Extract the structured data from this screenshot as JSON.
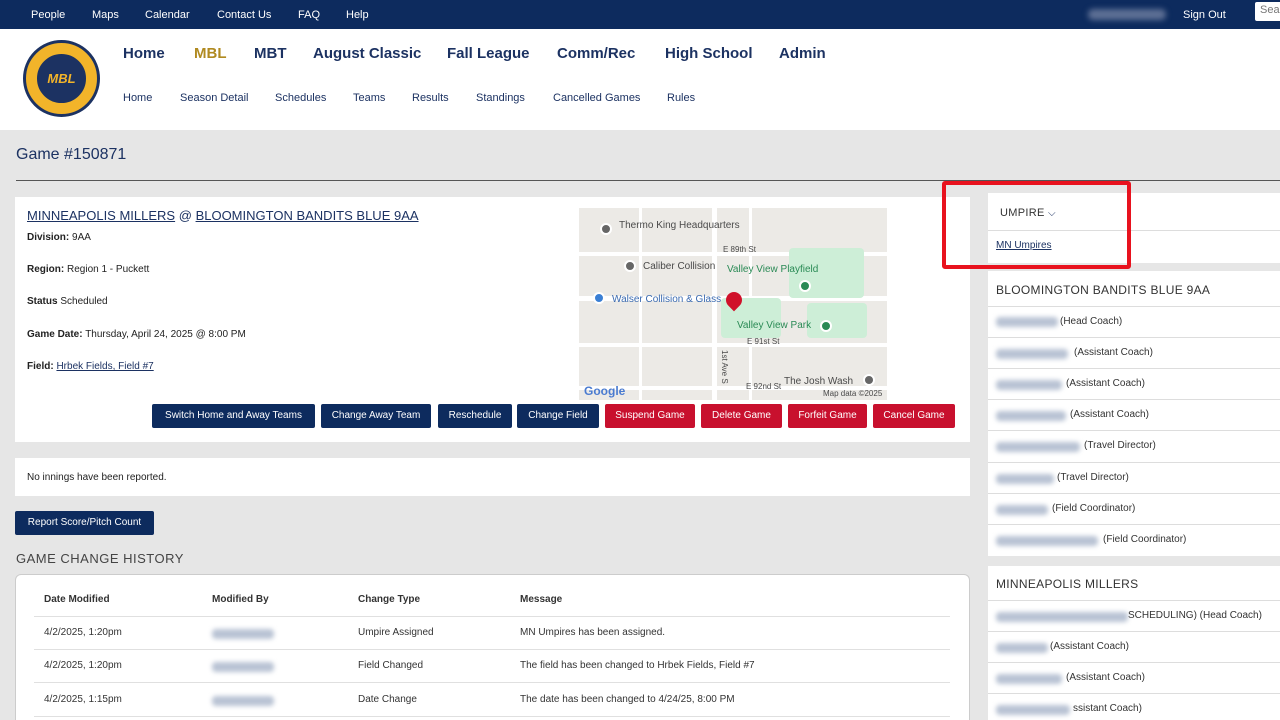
{
  "topnav": {
    "people": "People",
    "maps": "Maps",
    "calendar": "Calendar",
    "contact": "Contact Us",
    "faq": "FAQ",
    "help": "Help",
    "signout": "Sign Out",
    "search_placeholder": "Sea"
  },
  "logo": {
    "text": "MBL"
  },
  "mainnav": [
    "Home",
    "MBL",
    "MBT",
    "August Classic",
    "Fall League",
    "Comm/Rec",
    "High School",
    "Admin"
  ],
  "subnav": [
    "Home",
    "Season Detail",
    "Schedules",
    "Teams",
    "Results",
    "Standings",
    "Cancelled Games",
    "Rules"
  ],
  "page_title": "Game #150871",
  "game": {
    "away_team": "MINNEAPOLIS MILLERS",
    "at": "@",
    "home_team": "BLOOMINGTON BANDITS BLUE 9AA",
    "division_label": "Division:",
    "division": "9AA",
    "region_label": "Region:",
    "region": "Region 1 - Puckett",
    "status_label": "Status",
    "status": "Scheduled",
    "date_label": "Game Date:",
    "date": "Thursday, April 24, 2025 @ 8:00 PM",
    "field_label": "Field:",
    "field": "Hrbek Fields, Field #7"
  },
  "map": {
    "labels": [
      "Thermo King Headquarters",
      "E 89th St",
      "Caliber Collision",
      "Valley View Playfield",
      "Walser Collision & Glass",
      "Valley View Park",
      "E 91st St",
      "1st Ave S",
      "E 92nd St",
      "The Josh Wash",
      "Google",
      "Map data ©2025"
    ]
  },
  "buttons": {
    "switch": "Switch Home and Away Teams",
    "change_away": "Change Away Team",
    "reschedule": "Reschedule",
    "change_field": "Change Field",
    "suspend": "Suspend Game",
    "delete": "Delete Game",
    "forfeit": "Forfeit Game",
    "cancel": "Cancel Game"
  },
  "innings_msg": "No innings have been reported.",
  "report_btn": "Report Score/Pitch Count",
  "history": {
    "title": "GAME CHANGE HISTORY",
    "headers": [
      "Date Modified",
      "Modified By",
      "Change Type",
      "Message"
    ],
    "rows": [
      {
        "date": "4/2/2025, 1:20pm",
        "type": "Umpire Assigned",
        "msg": "MN Umpires has been assigned."
      },
      {
        "date": "4/2/2025, 1:20pm",
        "type": "Field Changed",
        "msg": "The field has been changed to Hrbek Fields, Field #7"
      },
      {
        "date": "4/2/2025, 1:15pm",
        "type": "Date Change",
        "msg": "The date has been changed to 4/24/25, 8:00 PM"
      }
    ]
  },
  "umpire": {
    "title": "UMPIRE",
    "name": "MN Umpires"
  },
  "home_staff": {
    "title": "BLOOMINGTON BANDITS BLUE 9AA",
    "roles": [
      "(Head Coach)",
      "(Assistant Coach)",
      "(Assistant Coach)",
      "(Assistant Coach)",
      "(Travel Director)",
      "(Travel Director)",
      "(Field Coordinator)",
      "(Field Coordinator)"
    ]
  },
  "away_staff": {
    "title": "MINNEAPOLIS MILLERS",
    "roles": [
      "SCHEDULING) (Head Coach)",
      "(Assistant Coach)",
      "(Assistant Coach)",
      "ssistant Coach)"
    ]
  }
}
